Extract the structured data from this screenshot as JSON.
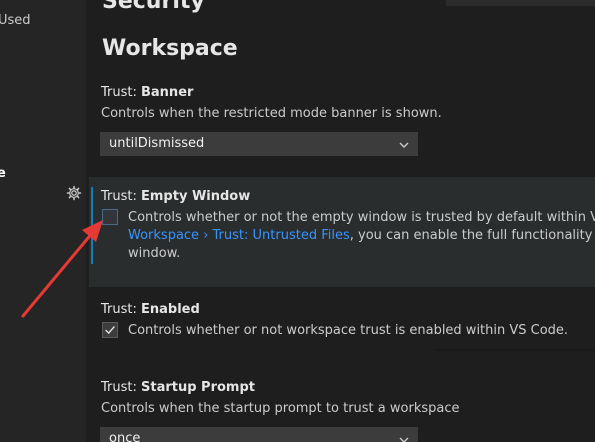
{
  "sidebar": {
    "items": [
      {
        "label": "Used"
      },
      {
        "label": "e"
      }
    ]
  },
  "main": {
    "section_prev": "Security",
    "section": "Workspace",
    "settings": [
      {
        "category": "Trust: ",
        "name": "Banner",
        "description": "Controls when the restricted mode banner is shown.",
        "control": "select",
        "value": "untilDismissed"
      },
      {
        "category": "Trust: ",
        "name": "Empty Window",
        "description_line1": "Controls whether or not the empty window is trusted by default within VS Code. W",
        "link1": "Workspace",
        "sep": " › ",
        "link2": "Trust: Untrusted Files",
        "line2_rest": ", you can enable the full functionality of VS Code",
        "description_line3": "window.",
        "control": "checkbox",
        "checked": false
      },
      {
        "category": "Trust: ",
        "name": "Enabled",
        "description": "Controls whether or not workspace trust is enabled within VS Code.",
        "control": "checkbox",
        "checked": true
      },
      {
        "category": "Trust: ",
        "name": "Startup Prompt",
        "description": "Controls when the startup prompt to trust a workspace",
        "control": "select",
        "value": "once"
      }
    ]
  },
  "icons": {
    "gear": "gear-icon",
    "chevron": "chevron-down-icon",
    "check": "check-icon"
  },
  "colors": {
    "link": "#3794ff",
    "focus": "#0e7fb7",
    "annotation_arrow": "#e53935"
  }
}
